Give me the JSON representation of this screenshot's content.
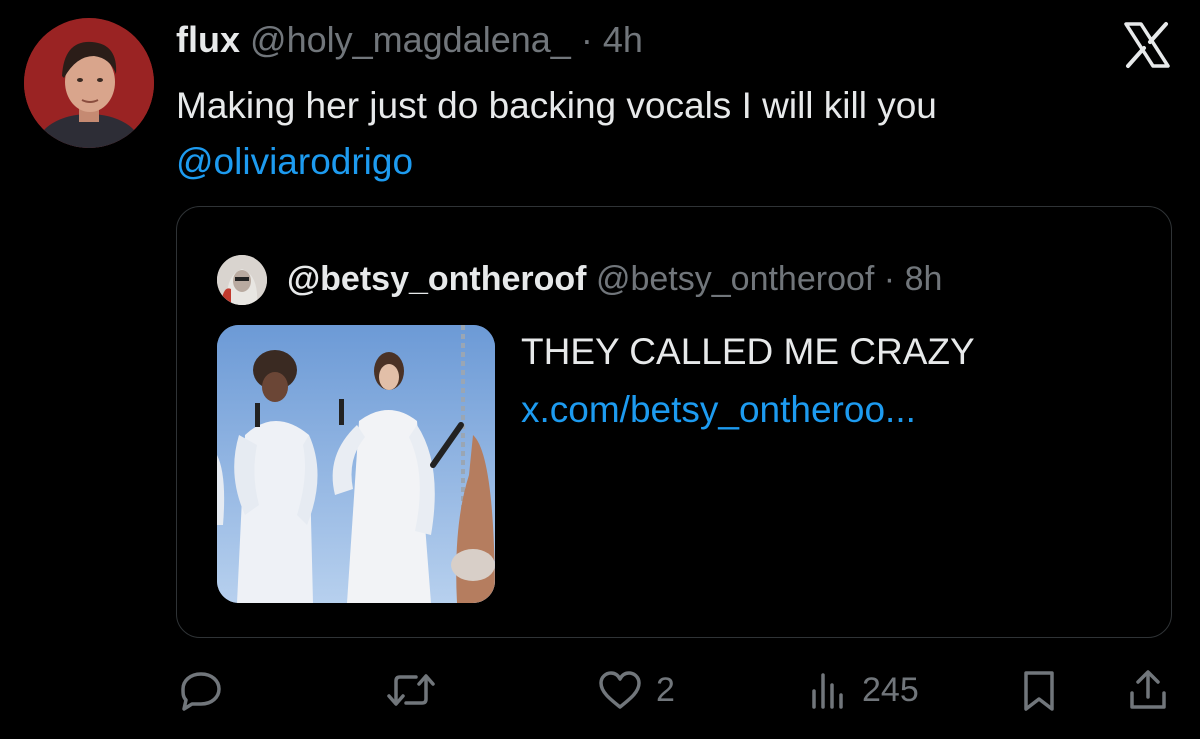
{
  "tweet": {
    "author_name": "flux",
    "author_handle": "@holy_magdalena_",
    "separator": "·",
    "time": "4h",
    "text": "Making her just do backing vocals I will kill you",
    "mention": "@oliviarodrigo"
  },
  "quote": {
    "author_name": "@betsy_ontheroof",
    "author_handle": "@betsy_ontheroof",
    "separator": "·",
    "time": "8h",
    "text": "THEY CALLED ME CRAZY",
    "link": "x.com/betsy_ontheroo..."
  },
  "actions": {
    "reply_icon": "reply-icon",
    "retweet_icon": "retweet-icon",
    "like_icon": "heart-icon",
    "like_count": "2",
    "views_icon": "views-icon",
    "views_count": "245",
    "bookmark_icon": "bookmark-icon",
    "share_icon": "share-icon"
  },
  "colors": {
    "background": "#000000",
    "text": "#e7e9ea",
    "muted": "#71767b",
    "accent": "#1d9bf0",
    "border": "#2f3336"
  }
}
